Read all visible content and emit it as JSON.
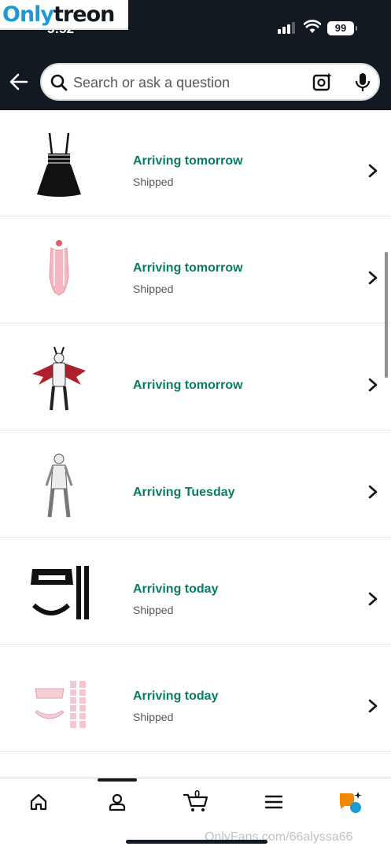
{
  "watermark": {
    "part1": "Only",
    "part2": "treon"
  },
  "status_bar": {
    "time": "5:52",
    "battery": "99"
  },
  "search": {
    "placeholder": "Search or ask a question"
  },
  "orders": [
    {
      "status": "Arriving tomorrow",
      "sub": "Shipped",
      "image": "black-suspender-skirt"
    },
    {
      "status": "Arriving tomorrow",
      "sub": "Shipped",
      "image": "pink-bodysuit"
    },
    {
      "status": "Arriving tomorrow",
      "sub": "",
      "image": "devil-costume"
    },
    {
      "status": "Arriving Tuesday",
      "sub": "",
      "image": "white-bodysuit-costume"
    },
    {
      "status": "Arriving today",
      "sub": "Shipped",
      "image": "black-crop-top-set"
    },
    {
      "status": "Arriving today",
      "sub": "Shipped",
      "image": "pink-striped-set"
    }
  ],
  "bottom_nav": {
    "items": [
      "home-icon",
      "account-icon",
      "cart-icon",
      "menu-icon",
      "rufus-icon"
    ],
    "cart_count": "0"
  },
  "footer_watermark": "OnlyFans.com/66alyssa66",
  "colors": {
    "topbar": "#131921",
    "status_green": "#067d62",
    "accent_orange": "#f08804",
    "accent_blue": "#1d9bd1"
  }
}
